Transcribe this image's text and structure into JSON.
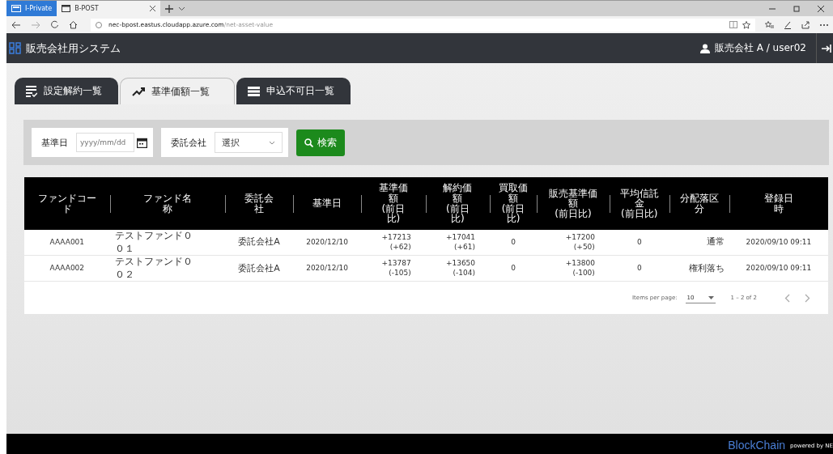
{
  "browser": {
    "tabs": [
      {
        "label": "I-Private",
        "kind": "private",
        "selected": false
      },
      {
        "label": "B-POST",
        "kind": "page",
        "selected": true
      }
    ],
    "address": {
      "host": "nec-bpost.eastus.cloudapp.azure.com",
      "path": "/net-asset-value"
    }
  },
  "app": {
    "title": "販売会社用システム",
    "user": "販売会社 A / user02"
  },
  "tabs": [
    {
      "label": "設定解約一覧",
      "kind": "list",
      "selected": false
    },
    {
      "label": "基準価額一覧",
      "kind": "trend",
      "selected": true
    },
    {
      "label": "申込不可日一覧",
      "kind": "bars",
      "selected": false
    }
  ],
  "filters": {
    "date_label": "基準日",
    "date_placeholder": "yyyy/mm/dd",
    "company_label": "委託会社",
    "company_value": "選択",
    "search_button": "検索"
  },
  "table": {
    "columns": [
      [
        "ファンドコー",
        "ド"
      ],
      [
        "ファンド名",
        "称"
      ],
      [
        "委託会",
        "社"
      ],
      [
        "基準日"
      ],
      [
        "基準価",
        "額",
        "(前日",
        "比)"
      ],
      [
        "解約価",
        "額",
        "(前日",
        "比)"
      ],
      [
        "買取価",
        "額",
        "(前日",
        "比)"
      ],
      [
        "販売基準価",
        "額",
        "(前日比)"
      ],
      [
        "平均信託",
        "金",
        "(前日比)"
      ],
      [
        "分配落区",
        "分"
      ],
      [
        "登録日",
        "時"
      ]
    ],
    "rows": [
      {
        "code": "AAAA001",
        "name": [
          "テストファンド０",
          "０１"
        ],
        "company": "委託会社A",
        "date": "2020/12/10",
        "nav": [
          "+17213",
          "(+62)"
        ],
        "cancel": [
          "+17041",
          "(+61)"
        ],
        "buy": "0",
        "sales": [
          "+17200",
          "(+50)"
        ],
        "trust": "0",
        "dist": "通常",
        "registered": "2020/09/10 09:11"
      },
      {
        "code": "AAAA002",
        "name": [
          "テストファンド０",
          "０２"
        ],
        "company": "委託会社A",
        "date": "2020/12/10",
        "nav": [
          "+13787",
          "(-105)"
        ],
        "cancel": [
          "+13650",
          "(-104)"
        ],
        "buy": "0",
        "sales": [
          "+13800",
          "(-100)"
        ],
        "trust": "0",
        "dist": "権利落ち",
        "registered": "2020/09/10 09:11"
      }
    ],
    "paginator": {
      "label": "Items per page:",
      "page_size": "10",
      "range": "1 – 2 of 2"
    }
  },
  "footer": {
    "brand": "BlockChain",
    "powered": "powered by NE"
  }
}
